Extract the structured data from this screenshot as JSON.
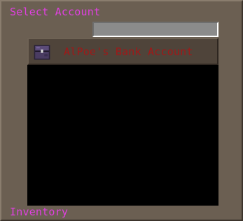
{
  "window": {
    "title": "Select Account",
    "inventory_label": "Inventory"
  },
  "search": {
    "value": ""
  },
  "accounts": [
    {
      "label": "AlPoe's Bank Account",
      "icon": "ender-chest-icon"
    }
  ],
  "colors": {
    "title_text": "#e040e0",
    "account_text": "#a01818",
    "panel_bg": "#6b5f52",
    "list_bg": "#000000"
  }
}
